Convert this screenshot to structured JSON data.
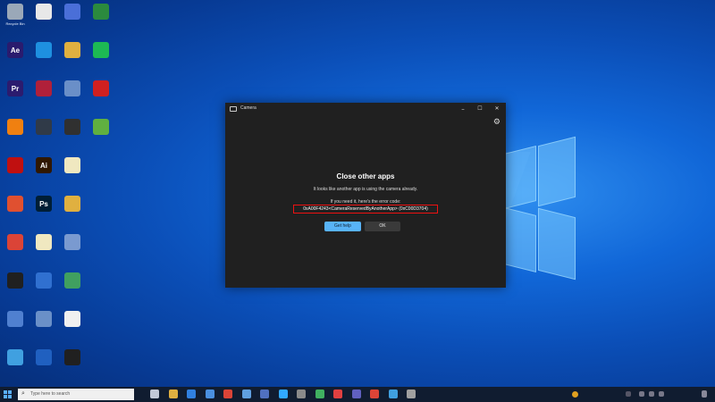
{
  "desktop": {
    "icons": [
      {
        "label": "Recycle Bin",
        "icon": "recycle-bin-icon",
        "color": "#9aa8b8"
      },
      {
        "label": "",
        "icon": "document-icon",
        "color": "#e8e8e8"
      },
      {
        "label": "",
        "icon": "shortcut-icon",
        "color": "#4a6fd8"
      },
      {
        "label": "",
        "icon": "app-icon",
        "color": "#2b8a3e"
      },
      {
        "label": "",
        "icon": "after-effects-icon",
        "glyph": "Ae",
        "color": "#2a1b6e"
      },
      {
        "label": "",
        "icon": "skype-icon",
        "color": "#1e90e0"
      },
      {
        "label": "",
        "icon": "folder-icon",
        "color": "#e0b040"
      },
      {
        "label": "",
        "icon": "spotify-icon",
        "color": "#1db954"
      },
      {
        "label": "",
        "icon": "premiere-pro-icon",
        "glyph": "Pr",
        "color": "#2c1b6e"
      },
      {
        "label": "",
        "icon": "app-icon",
        "color": "#b0203a"
      },
      {
        "label": "",
        "icon": "app-icon",
        "color": "#6a8fc8"
      },
      {
        "label": "",
        "icon": "app-icon",
        "color": "#d02020"
      },
      {
        "label": "",
        "icon": "vlc-icon",
        "color": "#f08010"
      },
      {
        "label": "",
        "icon": "app-icon",
        "color": "#303a48"
      },
      {
        "label": "",
        "icon": "app-icon",
        "color": "#303030"
      },
      {
        "label": "",
        "icon": "app-icon",
        "color": "#60b040"
      },
      {
        "label": "",
        "icon": "app-icon",
        "color": "#c01010"
      },
      {
        "label": "",
        "icon": "illustrator-icon",
        "glyph": "Ai",
        "color": "#301800"
      },
      {
        "label": "",
        "icon": "document-icon",
        "color": "#f0e8c0"
      },
      {
        "label": "",
        "icon": "blank",
        "color": "transparent"
      },
      {
        "label": "",
        "icon": "firefox-icon",
        "color": "#e05030"
      },
      {
        "label": "",
        "icon": "photoshop-icon",
        "glyph": "Ps",
        "color": "#001e36"
      },
      {
        "label": "",
        "icon": "folder-icon",
        "color": "#e0b040"
      },
      {
        "label": "",
        "icon": "blank",
        "color": "transparent"
      },
      {
        "label": "",
        "icon": "chrome-icon",
        "color": "#db4437"
      },
      {
        "label": "",
        "icon": "document-icon",
        "color": "#f0e8c0"
      },
      {
        "label": "",
        "icon": "app-icon",
        "color": "#7a9ad0"
      },
      {
        "label": "",
        "icon": "blank",
        "color": "transparent"
      },
      {
        "label": "",
        "icon": "logitech-icon",
        "color": "#202020"
      },
      {
        "label": "",
        "icon": "app-icon",
        "color": "#3070d0"
      },
      {
        "label": "",
        "icon": "app-icon",
        "color": "#40a060"
      },
      {
        "label": "",
        "icon": "blank",
        "color": "transparent"
      },
      {
        "label": "",
        "icon": "app-icon",
        "color": "#5080d0"
      },
      {
        "label": "",
        "icon": "app-icon",
        "color": "#6a90c8"
      },
      {
        "label": "",
        "icon": "document-icon",
        "color": "#f0f0f0"
      },
      {
        "label": "",
        "icon": "blank",
        "color": "transparent"
      },
      {
        "label": "",
        "icon": "app-icon",
        "color": "#40a0e0"
      },
      {
        "label": "",
        "icon": "app-icon",
        "color": "#2060c0"
      },
      {
        "label": "",
        "icon": "app-icon",
        "color": "#202020"
      }
    ]
  },
  "camera_window": {
    "title": "Camera",
    "minimize_glyph": "–",
    "maximize_glyph": "☐",
    "close_glyph": "✕",
    "settings_glyph": "⚙",
    "heading": "Close other apps",
    "message": "It looks like another app is using the camera already.",
    "error_intro": "If you need it, here's the error code:",
    "error_code": "0xA00F4243<CameraReservedByAnotherApp> (0xC00D3704)",
    "help_button": "Get help",
    "ok_button": "OK",
    "accent_color": "#58b3f7",
    "highlight_color": "#ee1111"
  },
  "taskbar": {
    "search_placeholder": "Type here to search",
    "apps": [
      {
        "icon": "task-view-icon",
        "color": "#c0c8d8"
      },
      {
        "icon": "file-explorer-icon",
        "color": "#e0b040"
      },
      {
        "icon": "mail-icon",
        "color": "#3080e0"
      },
      {
        "icon": "store-icon",
        "color": "#4a90e0"
      },
      {
        "icon": "chrome-icon",
        "color": "#db4437"
      },
      {
        "icon": "photos-icon",
        "color": "#60a0e0"
      },
      {
        "icon": "app-icon",
        "color": "#5070c0"
      },
      {
        "icon": "photoshop-icon",
        "color": "#31a8ff"
      },
      {
        "icon": "app-icon",
        "color": "#8a8a8a"
      },
      {
        "icon": "app-icon",
        "color": "#40b060"
      },
      {
        "icon": "app-icon",
        "color": "#e04040"
      },
      {
        "icon": "app-icon",
        "color": "#6060c0"
      },
      {
        "icon": "chrome-icon",
        "color": "#db4437"
      },
      {
        "icon": "app-icon",
        "color": "#40a0e0"
      },
      {
        "icon": "app-icon",
        "color": "#a0a0a0"
      }
    ]
  }
}
